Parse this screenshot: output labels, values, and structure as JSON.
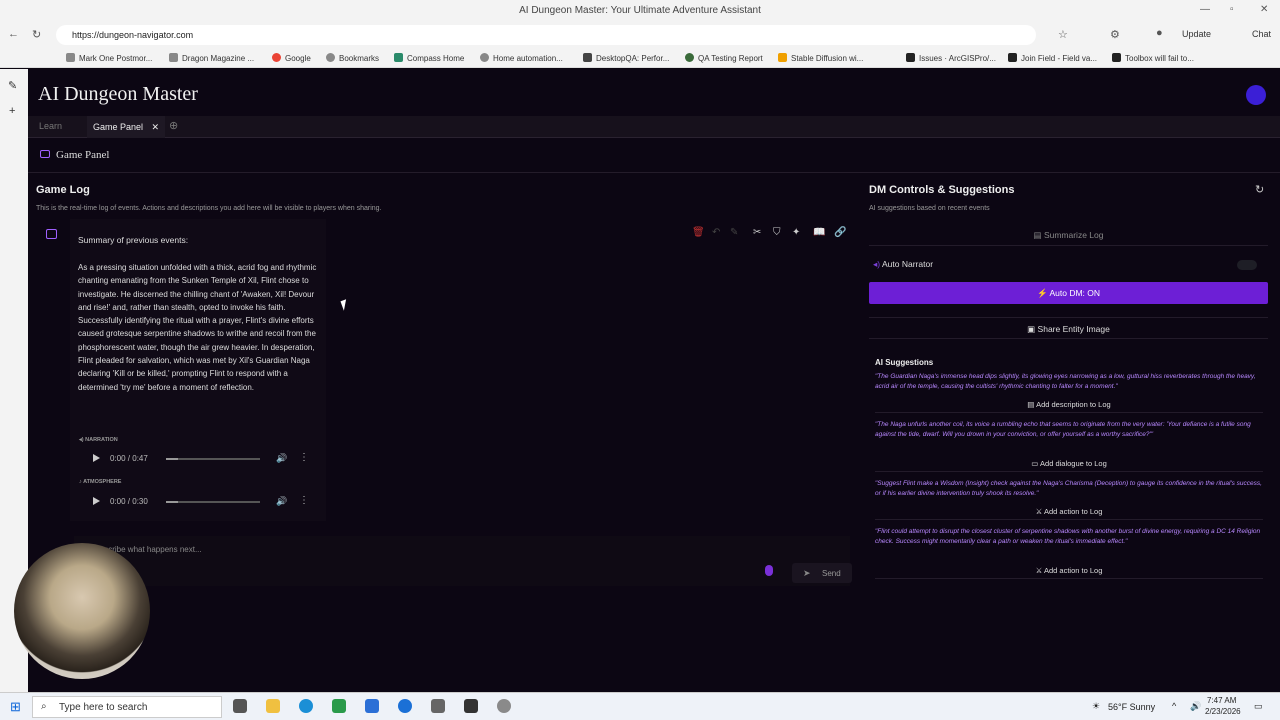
{
  "browser": {
    "title": "AI Dungeon Master: Your Ultimate Adventure Assistant",
    "url": "https://dungeon-navigator.com",
    "update_label": "Update",
    "chat_label": "Chat",
    "bookmarks": [
      "Mark One Postmor...",
      "Dragon Magazine ...",
      "Google",
      "Bookmarks",
      "Compass Home",
      "Home automation...",
      "DesktopQA: Perfor...",
      "QA Testing Report",
      "Stable Diffusion wi...",
      "Issues · ArcGISPro/...",
      "Join Field - Field va...",
      "Toolbox will fail to..."
    ]
  },
  "app": {
    "title": "AI Dungeon Master",
    "tabs": {
      "learn": "Learn",
      "game_panel": "Game Panel"
    },
    "panel_title": "Game Panel"
  },
  "game_log": {
    "title": "Game Log",
    "subtitle": "This is the real-time log of events. Actions and descriptions you add here will be visible to players when sharing.",
    "entry_title": "Summary of previous events:",
    "entry_body": "As a pressing situation unfolded with a thick, acrid fog and rhythmic chanting emanating from the Sunken Temple of Xil, Flint chose to investigate. He discerned the chilling chant of 'Awaken, Xil! Devour and rise!' and, rather than stealth, opted to invoke his faith. Successfully identifying the ritual with a prayer, Flint's divine efforts caused grotesque serpentine shadows to writhe and recoil from the phosphorescent water, though the air grew heavier. In desperation, Flint pleaded for salvation, which was met by Xil's Guardian Naga declaring 'Kill or be killed,' prompting Flint to respond with a determined 'try me' before a moment of reflection.",
    "narration_label": "NARRATION",
    "narration_time": "0:00 / 0:47",
    "atmosphere_label": "ATMOSPHERE",
    "atmosphere_time": "0:00 / 0:30",
    "progress": 0,
    "input_placeholder": "Describe what happens next...",
    "send_label": "Send"
  },
  "dm_controls": {
    "title": "DM Controls & Suggestions",
    "subtitle": "AI suggestions based on recent events",
    "summarize_label": "Summarize Log",
    "auto_narrator_label": "Auto Narrator",
    "auto_narrator_on": false,
    "auto_dm_label": "Auto DM: ON",
    "share_label": "Share Entity Image",
    "suggestions_title": "AI Suggestions",
    "suggestions": [
      {
        "text": "\"The Guardian Naga's immense head dips slightly, its glowing eyes narrowing as a low, guttural hiss reverberates through the heavy, acrid air of the temple, causing the cultists' rhythmic chanting to falter for a moment.\"",
        "action": "Add description to Log"
      },
      {
        "text": "\"The Naga unfurls another coil, its voice a rumbling echo that seems to originate from the very water: 'Your defiance is a futile song against the tide, dwarf. Will you drown in your conviction, or offer yourself as a worthy sacrifice?'\"",
        "action": "Add dialogue to Log"
      },
      {
        "text": "\"Suggest Flint make a Wisdom (Insight) check against the Naga's Charisma (Deception) to gauge its confidence in the ritual's success, or if his earlier divine intervention truly shook its resolve.\"",
        "action": "Add action to Log"
      },
      {
        "text": "\"Flint could attempt to disrupt the closest cluster of serpentine shadows with another burst of divine energy, requiring a DC 14 Religion check. Success might momentarily clear a path or weaken the ritual's immediate effect.\"",
        "action": "Add action to Log"
      }
    ]
  },
  "taskbar": {
    "search_placeholder": "Type here to search",
    "weather": "56°F  Sunny",
    "time": "7:47 AM",
    "date": "2/23/2026"
  },
  "colors": {
    "accent": "#6d1fd6",
    "suggestion": "#b888ff"
  }
}
